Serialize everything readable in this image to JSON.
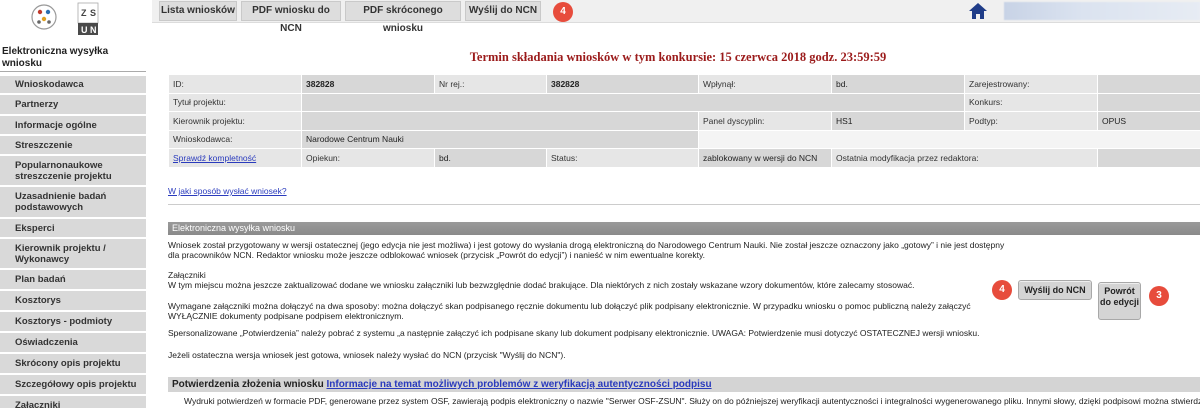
{
  "topbar": {
    "tabs": [
      "Lista wniosków",
      "PDF wniosku do NCN",
      "PDF skróconego wniosku",
      "Wyślij do NCN"
    ],
    "tab_badge": "4"
  },
  "sidebar": {
    "title": "Elektroniczna wysyłka wniosku",
    "items": [
      "Wnioskodawca",
      "Partnerzy",
      "Informacje ogólne",
      "Streszczenie",
      "Popularnonaukowe streszczenie projektu",
      "Uzasadnienie badań podstawowych",
      "Eksperci",
      "Kierownik projektu / Wykonawcy",
      "Plan badań",
      "Kosztorys",
      "Kosztorys - podmioty",
      "Oświadczenia",
      "Skrócony opis projektu",
      "Szczegółowy opis projektu",
      "Załączniki"
    ]
  },
  "main": {
    "deadline": "Termin składania wniosków w tym konkursie: 15 czerwca 2018 godz. 23:59:59",
    "info": {
      "id_label": "ID:",
      "id_value": "382828",
      "nr_label": "Nr rej.:",
      "nr_value": "382828",
      "wplynal_label": "Wpłynął:",
      "wplynal_value": "bd.",
      "zarejestrowany_label": "Zarejestrowany:",
      "tytul_label": "Tytuł projektu:",
      "konkurs_label": "Konkurs:",
      "kierownik_label": "Kierownik projektu:",
      "panel_label": "Panel dyscyplin:",
      "panel_value": "HS1",
      "podtyp_label": "Podtyp:",
      "podtyp_value": "OPUS",
      "wnioskodawca_label": "Wnioskodawca:",
      "wnioskodawca_value": "Narodowe Centrum Nauki",
      "sprawdz_link": "Sprawdź kompletność",
      "opiekun_label": "Opiekun:",
      "opiekun_value": "bd.",
      "status_label": "Status:",
      "status_value": "zablokowany w wersji do NCN",
      "modyfikacja_label": "Ostatnia modyfikacja przez redaktora:"
    },
    "howto_link": "W jaki sposób wysłać wniosek?",
    "section_title": "Elektroniczna wysyłka wniosku",
    "para1": "Wniosek został przygotowany w wersji ostatecznej (jego edycja nie jest możliwa) i jest gotowy do wysłania drogą elektroniczną do Narodowego Centrum Nauki. Nie został jeszcze oznaczony jako „gotowy” i nie jest dostępny dla pracowników NCN. Redaktor wniosku może jeszcze odblokować wniosek (przycisk „Powrót do edycji”) i nanieść w nim ewentualne korekty.",
    "para2_title": "Załączniki",
    "para2": "W tym miejscu można jeszcze zaktualizować dodane we wniosku załączniki lub bezwzględnie dodać brakujące. Dla niektórych z nich zostały wskazane wzory dokumentów, które zalecamy stosować.",
    "para3": "Wymagane załączniki można dołączyć na dwa sposoby: można dołączyć skan podpisanego ręcznie dokumentu lub dołączyć plik podpisany elektronicznie. W przypadku wniosku o pomoc publiczną należy załączyć WYŁĄCZNIE dokumenty podpisane podpisem elektronicznym.",
    "para4": "Spersonalizowane „Potwierdzenia” należy pobrać z systemu „a następnie załączyć ich podpisane skany lub dokument podpisany elektronicznie. UWAGA: Potwierdzenie musi dotyczyć OSTATECZNEJ wersji wniosku.",
    "para5": "Jeżeli ostateczna wersja wniosek jest gotowa, wniosek należy wysłać do NCN (przycisk \"Wyślij do NCN\").",
    "send_button": "Wyślij do NCN",
    "send_badge": "4",
    "back_button": "Powrót do edycji",
    "back_badge": "3",
    "confirm_title": "Potwierdzenia złożenia wniosku",
    "confirm_link": "Informacje na temat możliwych problemów z weryfikacją autentyczności podpisu",
    "bottom_text": "Wydruki potwierdzeń w formacie PDF, generowane przez system OSF, zawierają podpis elektroniczny o nazwie \"Serwer OSF-ZSUN\". Służy on do późniejszej weryfikacji autentyczności i integralności wygenerowanego pliku. Innymi słowy, dzięki podpisowi można stwierdzić czy dany"
  },
  "colors": {
    "badge": "#e74c3c",
    "deadline": "#9b1b1b",
    "link": "#2a3bbd"
  },
  "icons": {
    "home": "home-icon"
  }
}
